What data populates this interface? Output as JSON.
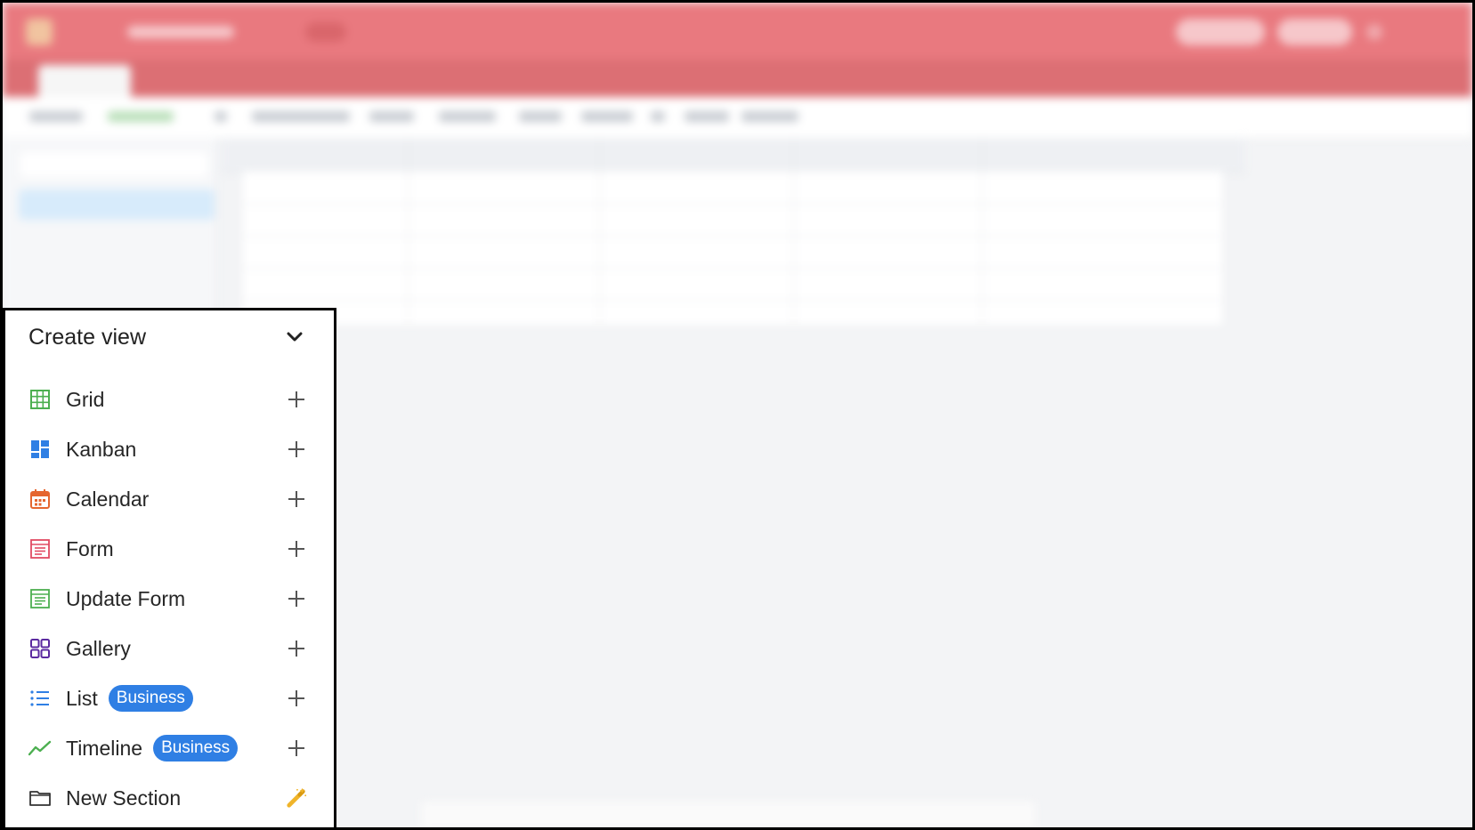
{
  "panel": {
    "title": "Create view",
    "collapse_icon": "chevron-down-icon",
    "items": [
      {
        "label": "Grid",
        "icon": "grid-icon",
        "color": "#4caf50",
        "action_icon": "plus-icon"
      },
      {
        "label": "Kanban",
        "icon": "kanban-icon",
        "color": "#2f7fe4",
        "action_icon": "plus-icon"
      },
      {
        "label": "Calendar",
        "icon": "calendar-icon",
        "color": "#e5662f",
        "action_icon": "plus-icon"
      },
      {
        "label": "Form",
        "icon": "form-icon",
        "color": "#e24b63",
        "action_icon": "plus-icon"
      },
      {
        "label": "Update Form",
        "icon": "update-form-icon",
        "color": "#4caf50",
        "action_icon": "plus-icon"
      },
      {
        "label": "Gallery",
        "icon": "gallery-icon",
        "color": "#5b2aa0",
        "action_icon": "plus-icon"
      },
      {
        "label": "List",
        "icon": "list-icon",
        "color": "#2f7fe4",
        "badge": "Business",
        "action_icon": "plus-icon"
      },
      {
        "label": "Timeline",
        "icon": "timeline-icon",
        "color": "#4caf50",
        "badge": "Business",
        "action_icon": "plus-icon"
      },
      {
        "label": "New Section",
        "icon": "folder-icon",
        "color": "#333333",
        "action_icon": "magic-wand-icon"
      }
    ]
  },
  "colors": {
    "topbar": "#e9797f",
    "badge": "#2f7fe4",
    "wand": "#f0b429"
  }
}
